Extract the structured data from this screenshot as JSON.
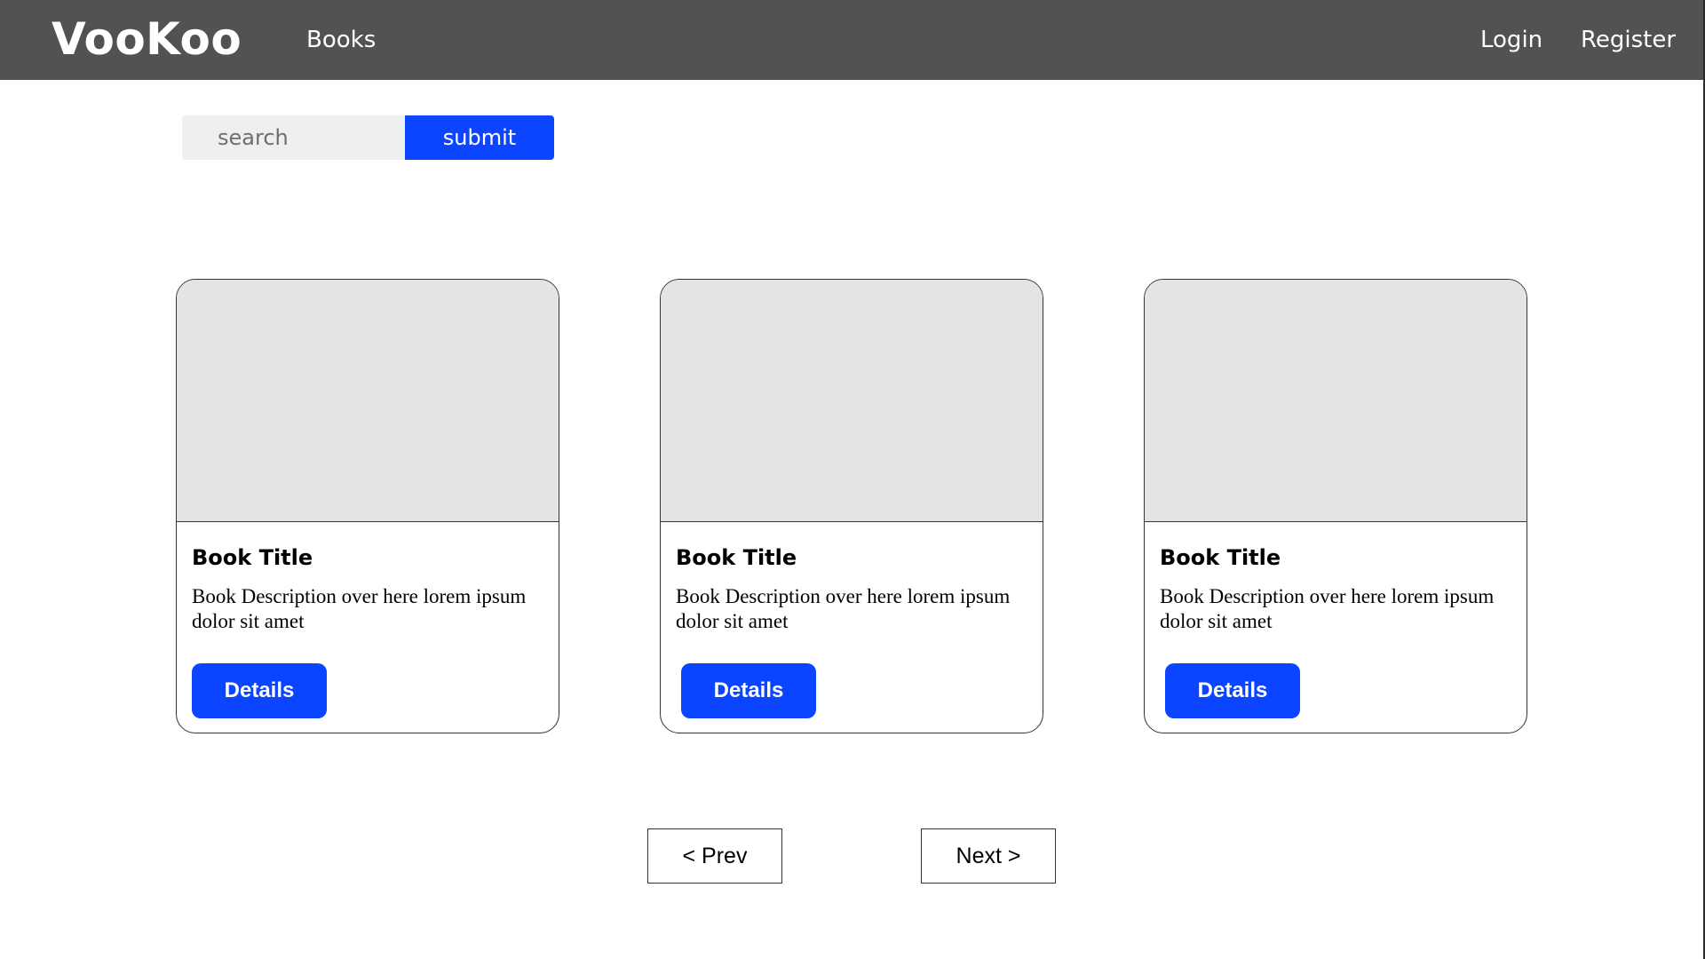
{
  "header": {
    "brand": "VooKoo",
    "nav": {
      "books": "Books",
      "login": "Login",
      "register": "Register"
    }
  },
  "search": {
    "placeholder": "search",
    "value": "",
    "submit_label": "submit"
  },
  "books": [
    {
      "title": "Book Title",
      "description": "Book Description over here lorem ipsum dolor sit amet",
      "details_label": "Details"
    },
    {
      "title": "Book Title",
      "description": "Book Description over here lorem ipsum dolor sit amet",
      "details_label": "Details"
    },
    {
      "title": "Book Title",
      "description": "Book Description over here lorem ipsum dolor sit amet",
      "details_label": "Details"
    }
  ],
  "pagination": {
    "prev_label": "< Prev",
    "next_label": "Next >"
  },
  "colors": {
    "header_bg": "#525252",
    "accent": "#0b45ff",
    "image_placeholder": "#e4e4e4",
    "search_bg": "#efefef"
  }
}
